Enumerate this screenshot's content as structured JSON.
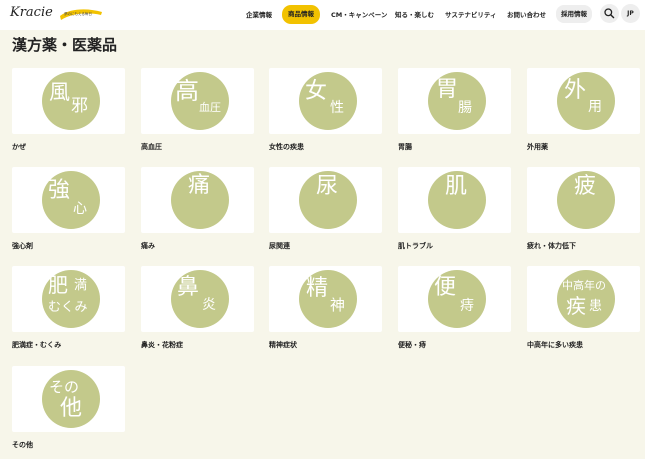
{
  "brand": {
    "name": "Kracie",
    "tagline": "夢のにもえる毎日"
  },
  "nav": {
    "items": [
      "企業情報",
      "商品情報",
      "CM・キャンペーン",
      "知る・楽しむ",
      "サステナビリティ",
      "お問い合わせ"
    ],
    "active_index": 1,
    "recruit": "採用情報",
    "language": "JP"
  },
  "page": {
    "title": "漢方薬・医薬品"
  },
  "categories": [
    {
      "label": "かぜ",
      "chars": [
        "風",
        "邪"
      ]
    },
    {
      "label": "高血圧",
      "chars": [
        "高",
        "血圧"
      ]
    },
    {
      "label": "女性の疾患",
      "chars": [
        "女",
        "性"
      ]
    },
    {
      "label": "胃腸",
      "chars": [
        "胃",
        "腸"
      ]
    },
    {
      "label": "外用薬",
      "chars": [
        "外",
        "用"
      ]
    },
    {
      "label": "強心剤",
      "chars": [
        "強",
        "心"
      ]
    },
    {
      "label": "痛み",
      "chars": [
        "痛"
      ]
    },
    {
      "label": "尿関連",
      "chars": [
        "尿"
      ]
    },
    {
      "label": "肌トラブル",
      "chars": [
        "肌"
      ]
    },
    {
      "label": "疲れ・体力低下",
      "chars": [
        "疲"
      ]
    },
    {
      "label": "肥満症・むくみ",
      "chars": [
        "肥",
        "満",
        "むくみ"
      ]
    },
    {
      "label": "鼻炎・花粉症",
      "chars": [
        "鼻",
        "炎"
      ]
    },
    {
      "label": "精神症状",
      "chars": [
        "精",
        "神"
      ]
    },
    {
      "label": "便秘・痔",
      "chars": [
        "便",
        "痔"
      ]
    },
    {
      "label": "中高年に多い疾患",
      "chars": [
        "中高年の",
        "疾",
        "患"
      ]
    },
    {
      "label": "その他",
      "chars": [
        "その",
        "他"
      ]
    }
  ],
  "colors": {
    "accent": "#f2c200",
    "circle": "#c3c98b",
    "background": "#f7f6ea"
  },
  "icons": {
    "search": "search-icon"
  }
}
